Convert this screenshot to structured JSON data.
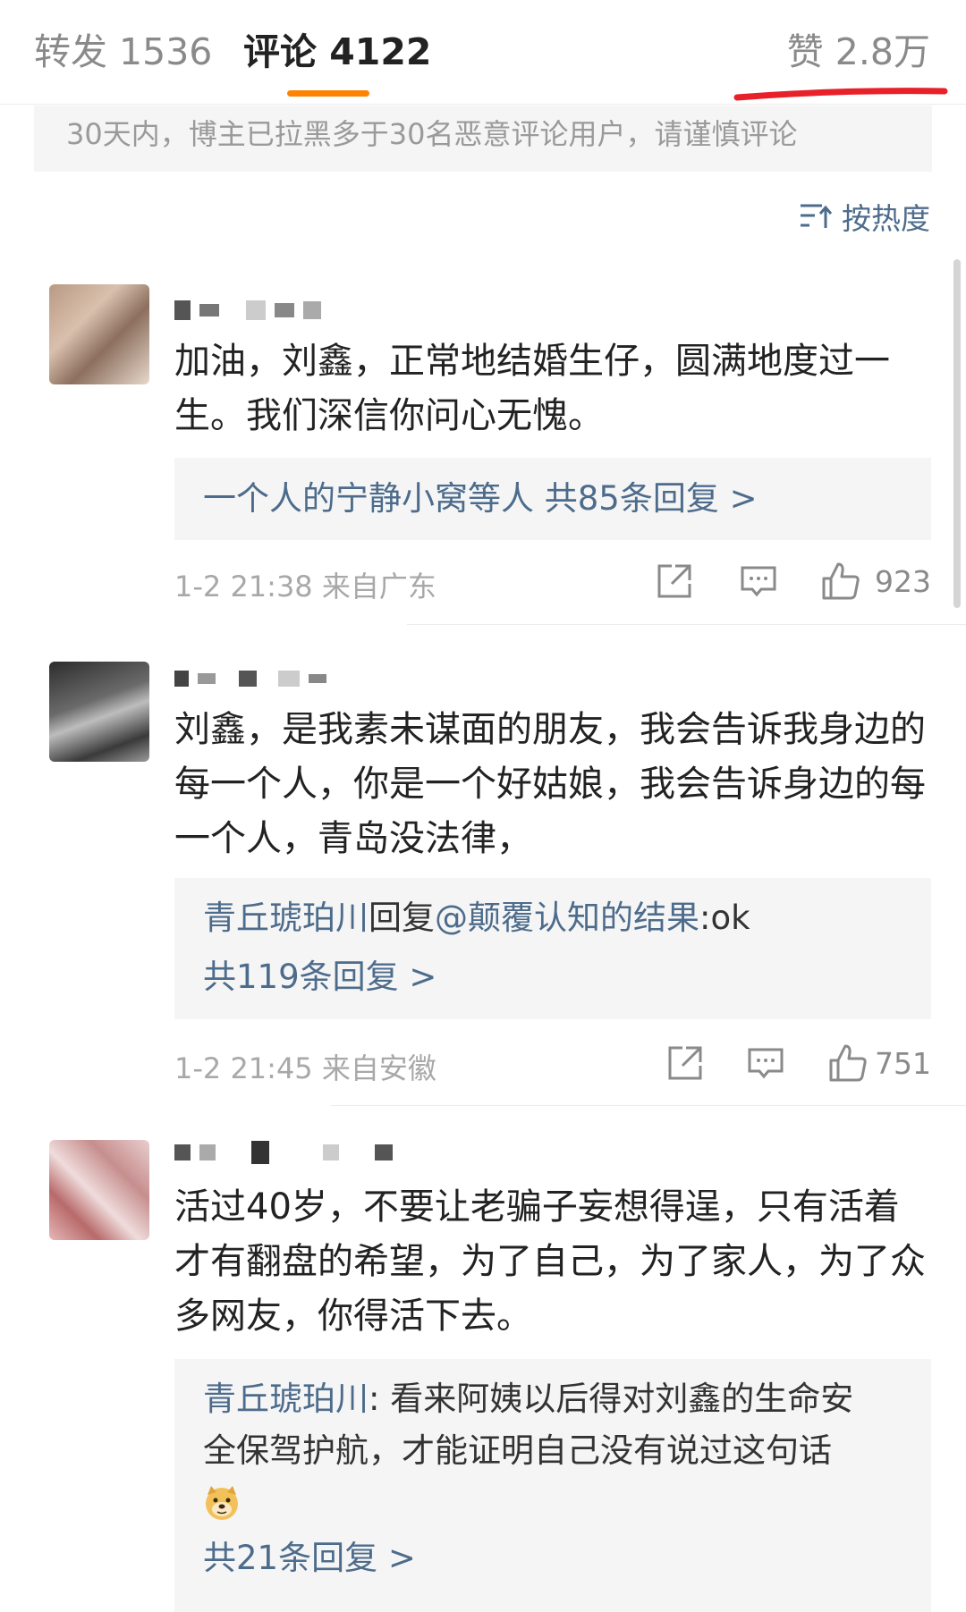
{
  "tabs": {
    "repost": "转发 1536",
    "comment": "评论 4122",
    "like": "赞 2.8万"
  },
  "notice": "30天内，博主已拉黑多于30名恶意评论用户，请谨慎评论",
  "sort_label": "按热度",
  "comments": [
    {
      "text": "加油，刘鑫，正常地结婚生仔，圆满地度过一生。我们深信你问心无愧。",
      "replies": {
        "line1": "一个人的宁静小窝等人  共85条回复 >"
      },
      "time": "1-2 21:38 来自广东",
      "likes": "923"
    },
    {
      "text": "刘鑫，是我素未谋面的朋友，我会告诉我身边的每一个人，你是一个好姑娘，我会告诉身边的每一个人，青岛没法律，",
      "replies": {
        "author": "青丘琥珀川",
        "action": "回复",
        "mention": "@颠覆认知的结果",
        "content": ":ok",
        "more": "共119条回复 >"
      },
      "time": "1-2 21:45 来自安徽",
      "likes": "751"
    },
    {
      "text": "活过40岁，不要让老骗子妄想得逞，只有活着才有翻盘的希望，为了自己，为了家人，为了众多网友，你得活下去。",
      "replies": {
        "author": "青丘琥珀川",
        "content_line1": ": 看来阿姨以后得对刘鑫的生命安",
        "content_line2": "全保驾护航，才能证明自己没有说过这句话",
        "emoji": "doge-emoji",
        "more": "共21条回复 >"
      }
    }
  ],
  "colors": {
    "accent": "#ff8200",
    "link": "#4d6c8c",
    "red_mark": "#e8202a"
  }
}
